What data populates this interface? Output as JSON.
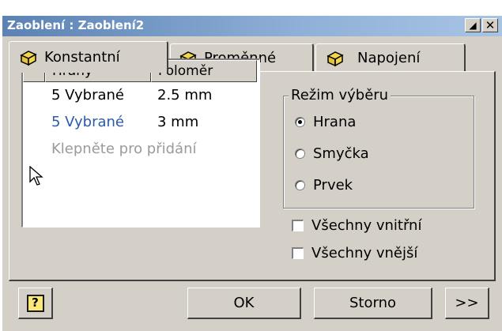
{
  "window": {
    "title": "Zaoblení : Zaoblení2",
    "pin_glyph": "◢",
    "close_glyph": "✕"
  },
  "tabs": [
    {
      "label": "Konstantní",
      "icon": "cube-icon",
      "active": true
    },
    {
      "label": "Proměnné",
      "icon": "cube-icon",
      "active": false
    },
    {
      "label": "Napojení",
      "icon": "cube-icon",
      "active": false
    }
  ],
  "edge_list": {
    "columns": [
      "Hrany",
      "Poloměr"
    ],
    "rows": [
      {
        "edges": "5 Vybrané",
        "radius": "2.5 mm",
        "selected": false
      },
      {
        "edges": "5 Vybrané",
        "radius": "3 mm",
        "selected": true
      }
    ],
    "add_prompt": "Klepněte pro přidání"
  },
  "selection_mode": {
    "label": "Režim výběru",
    "options": [
      "Hrana",
      "Smyčka",
      "Prvek"
    ],
    "selected": "Hrana"
  },
  "checkboxes": [
    {
      "label": "Všechny vnitřní",
      "checked": false
    },
    {
      "label": "Všechny vnější",
      "checked": false
    }
  ],
  "buttons": {
    "help_glyph": "?",
    "ok": "OK",
    "cancel": "Storno",
    "more": ">>"
  },
  "colors": {
    "face": "#d4d0c8",
    "title_start": "#5b82b3",
    "title_end": "#a8c4e4",
    "selected_text": "#2b5aa8",
    "disabled_text": "#9a9a9a",
    "cube_yellow": "#f3d64a"
  }
}
